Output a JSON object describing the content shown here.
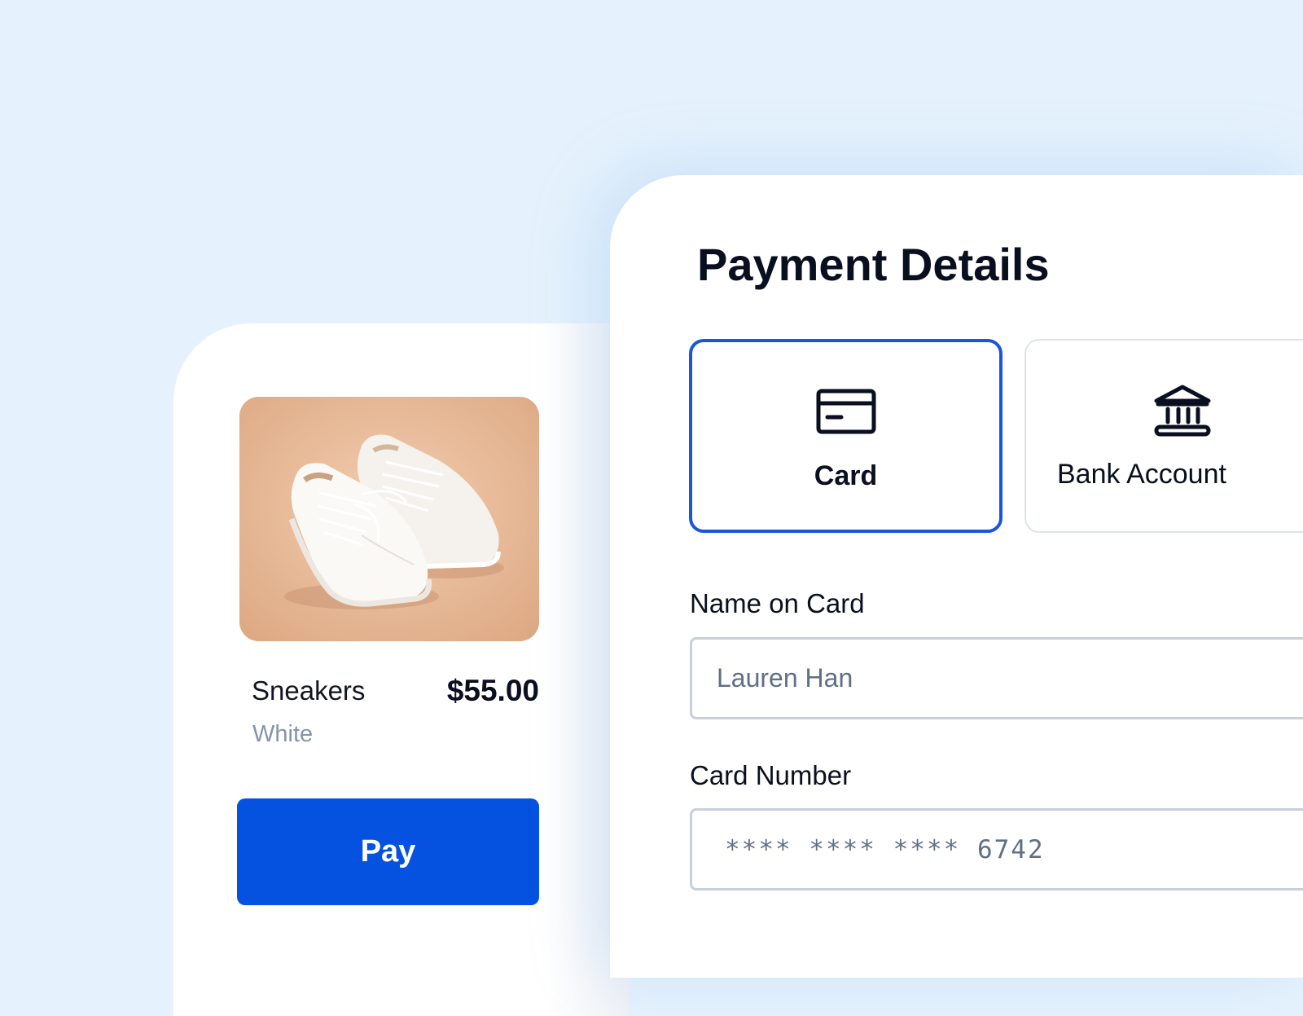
{
  "product": {
    "name": "Sneakers",
    "variant": "White",
    "price": "$55.00",
    "pay_label": "Pay",
    "image_icon": "sneakers-photo"
  },
  "payment": {
    "title": "Payment Details",
    "methods": [
      {
        "label": "Card",
        "icon": "credit-card-icon",
        "selected": true
      },
      {
        "label": "Bank Account",
        "icon": "bank-icon",
        "selected": false
      }
    ],
    "fields": {
      "name_label": "Name on Card",
      "name_value": "Lauren Han",
      "number_label": "Card Number",
      "number_value": "**** **** **** 6742"
    }
  },
  "colors": {
    "background": "#e5f2fd",
    "accent": "#0552e0",
    "selected_border": "#1a56db",
    "muted_text": "#8594ab"
  }
}
